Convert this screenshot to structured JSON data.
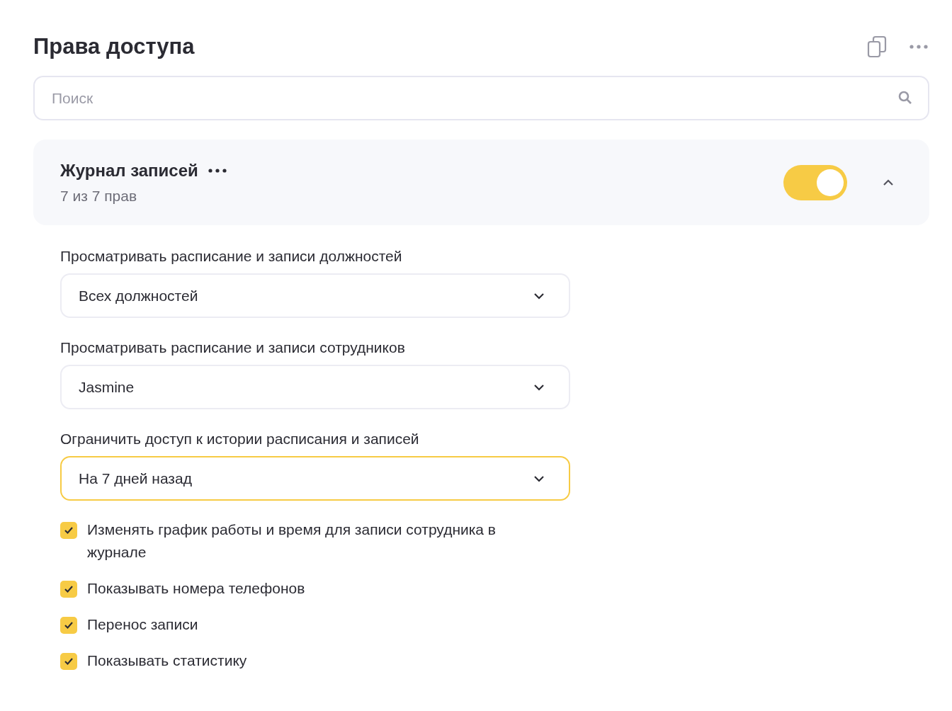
{
  "title": "Права доступа",
  "search": {
    "placeholder": "Поиск"
  },
  "section": {
    "title": "Журнал записей",
    "count": "7 из 7 прав",
    "enabled": true,
    "expanded": true
  },
  "selects": [
    {
      "label": "Просматривать расписание и записи должностей",
      "value": "Всех должностей",
      "focused": false
    },
    {
      "label": "Просматривать расписание и записи сотрудников",
      "value": "Jasmine",
      "focused": false
    },
    {
      "label": "Ограничить доступ к истории расписания и записей",
      "value": "На 7 дней назад",
      "focused": true
    }
  ],
  "checkboxes": [
    {
      "label": "Изменять график работы и время для записи сотрудника в журнале",
      "checked": true
    },
    {
      "label": "Показывать номера телефонов",
      "checked": true
    },
    {
      "label": "Перенос записи",
      "checked": true
    },
    {
      "label": "Показывать статистику",
      "checked": true
    }
  ]
}
